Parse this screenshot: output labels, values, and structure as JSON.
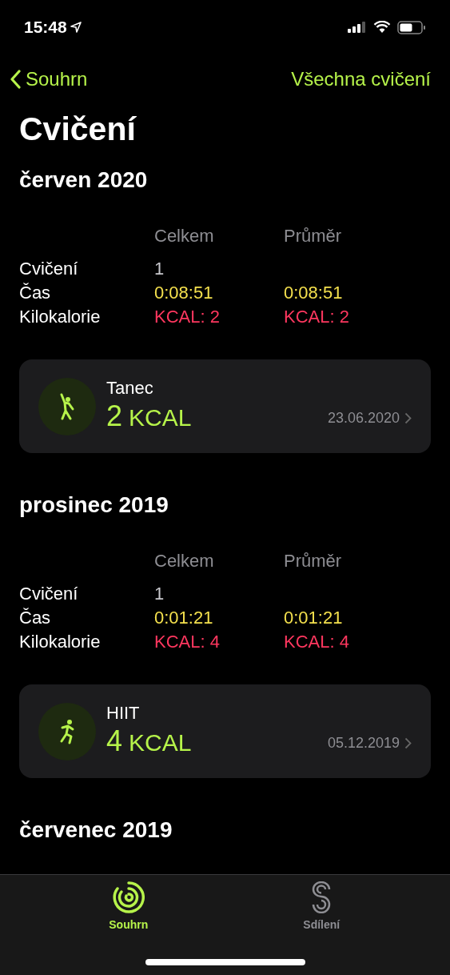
{
  "status_bar": {
    "time": "15:48"
  },
  "nav": {
    "back": "Souhrn",
    "action": "Všechna cvičení"
  },
  "title": "Cvičení",
  "sections": [
    {
      "month": "červen 2020",
      "columns": [
        "Celkem",
        "Průměr"
      ],
      "rows": [
        {
          "kind": "count",
          "label": "Cvičení",
          "total": "1"
        },
        {
          "kind": "time",
          "label": "Čas",
          "total": "0:08:51",
          "average": "0:08:51"
        },
        {
          "kind": "kcal",
          "label": "Kilokalorie",
          "total": "KCAL: 2",
          "average": "KCAL: 2"
        }
      ],
      "workouts": [
        {
          "kind": "dance",
          "name": "Tanec",
          "value": "2",
          "unit": "KCAL",
          "date": "23.06.2020"
        }
      ]
    },
    {
      "month": "prosinec 2019",
      "columns": [
        "Celkem",
        "Průměr"
      ],
      "rows": [
        {
          "kind": "count",
          "label": "Cvičení",
          "total": "1"
        },
        {
          "kind": "time",
          "label": "Čas",
          "total": "0:01:21",
          "average": "0:01:21"
        },
        {
          "kind": "kcal",
          "label": "Kilokalorie",
          "total": "KCAL: 4",
          "average": "KCAL: 4"
        }
      ],
      "workouts": [
        {
          "kind": "hiit",
          "name": "HIIT",
          "value": "4",
          "unit": "KCAL",
          "date": "05.12.2019"
        }
      ]
    },
    {
      "month": "červenec 2019"
    }
  ],
  "tabs": [
    {
      "kind": "summary",
      "label": "Souhrn",
      "selected": true
    },
    {
      "kind": "sharing",
      "label": "Sdílení",
      "selected": false
    }
  ]
}
